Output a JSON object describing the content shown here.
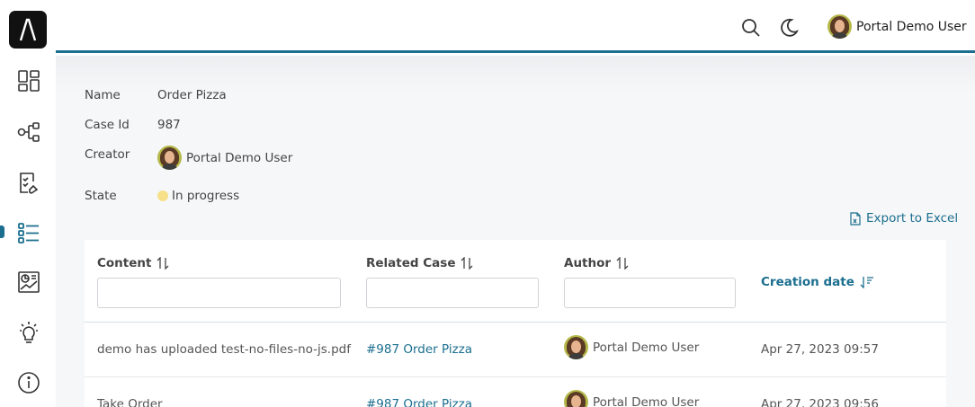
{
  "topbar": {
    "user_name": "Portal Demo User"
  },
  "case": {
    "name_label": "Name",
    "name_value": "Order Pizza",
    "id_label": "Case Id",
    "id_value": "987",
    "creator_label": "Creator",
    "creator_value": "Portal Demo User",
    "state_label": "State",
    "state_value": "In progress"
  },
  "export_label": "Export to Excel",
  "table": {
    "headers": {
      "content": "Content",
      "related_case": "Related Case",
      "author": "Author",
      "creation_date": "Creation date"
    },
    "rows": [
      {
        "content": "demo has uploaded test-no-files-no-js.pdf",
        "related_case": "#987 Order Pizza",
        "author": "Portal Demo User",
        "date": "Apr 27, 2023 09:57"
      },
      {
        "content": "Take Order",
        "related_case": "#987 Order Pizza",
        "author": "Portal Demo User",
        "date": "Apr 27, 2023 09:56"
      }
    ]
  },
  "colors": {
    "accent": "#1b6e8f",
    "state_in_progress": "#f6e08a"
  },
  "icons": [
    "logo-icon",
    "dashboard-icon",
    "process-icon",
    "task-icon",
    "case-list-icon",
    "statistics-icon",
    "idea-icon",
    "info-icon",
    "search-icon",
    "moon-icon",
    "excel-icon",
    "sort-icon"
  ]
}
